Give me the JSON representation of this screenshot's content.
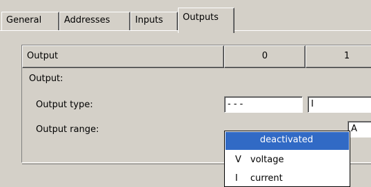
{
  "tabs": [
    {
      "label": "General"
    },
    {
      "label": "Addresses"
    },
    {
      "label": "Inputs"
    },
    {
      "label": "Outputs",
      "active": true
    }
  ],
  "table": {
    "header": {
      "label": "Output",
      "columns": [
        "0",
        "1"
      ]
    },
    "section_label": "Output:",
    "rows": [
      {
        "label": "Output type:",
        "values": [
          "- - -",
          "I"
        ]
      },
      {
        "label": "Output range:",
        "values": [
          "",
          "A"
        ]
      }
    ]
  },
  "dropdown": {
    "options": [
      {
        "symbol": "",
        "label": "deactivated",
        "selected": true
      },
      {
        "symbol": "V",
        "label": "voltage"
      },
      {
        "symbol": "I",
        "label": "current"
      }
    ]
  },
  "colors": {
    "selection": "#316ac5",
    "face": "#d4d0c8"
  }
}
